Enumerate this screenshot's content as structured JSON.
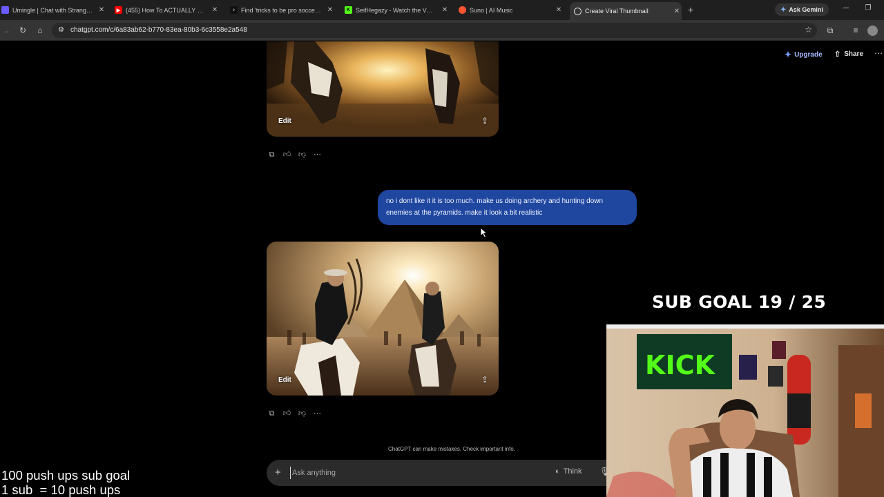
{
  "browser": {
    "tabs": [
      {
        "title": "Umingle | Chat with Strangers I",
        "icon": "umingle-icon",
        "color": "#6a5cff",
        "active": false
      },
      {
        "title": "(455) How To ACTUALLY Juggle",
        "icon": "youtube-icon",
        "color": "#ff0000",
        "active": false
      },
      {
        "title": "Find 'tricks to be pro soccer pla",
        "icon": "tiktok-icon",
        "color": "#111111",
        "active": false
      },
      {
        "title": "SeifHegazy - Watch the VOD o",
        "icon": "kick-icon",
        "color": "#53fc18",
        "active": false
      },
      {
        "title": "Suno | AI Music",
        "icon": "suno-icon",
        "color": "#ff5533",
        "active": false
      },
      {
        "title": "Create Viral Thumbnail",
        "icon": "chatgpt-icon",
        "color": "#dddddd",
        "active": true
      }
    ],
    "new_tab": "+",
    "gemini_label": "Ask Gemini",
    "url": "chatgpt.com/c/6a83ab62-b770-83ea-80b3-6c3558e2a548"
  },
  "header": {
    "upgrade_label": "Upgrade",
    "share_label": "Share"
  },
  "conversation": {
    "first_image": {
      "edit_label": "Edit"
    },
    "user_message": "no i dont like it it is too much. make us doing archery and hunting down enemies at the pyramids. make it look a bit realistic",
    "second_image": {
      "edit_label": "Edit"
    }
  },
  "composer": {
    "placeholder": "Ask anything",
    "think_label": "Think",
    "disclaimer": "ChatGPT can make mistakes. Check important info."
  },
  "overlay": {
    "sub_goal": "SUB GOAL 19 / 25",
    "pushups_line1": "100 push ups sub goal",
    "pushups_line2": "1 sub  = 10 push ups",
    "kick_banner": "KICK"
  }
}
